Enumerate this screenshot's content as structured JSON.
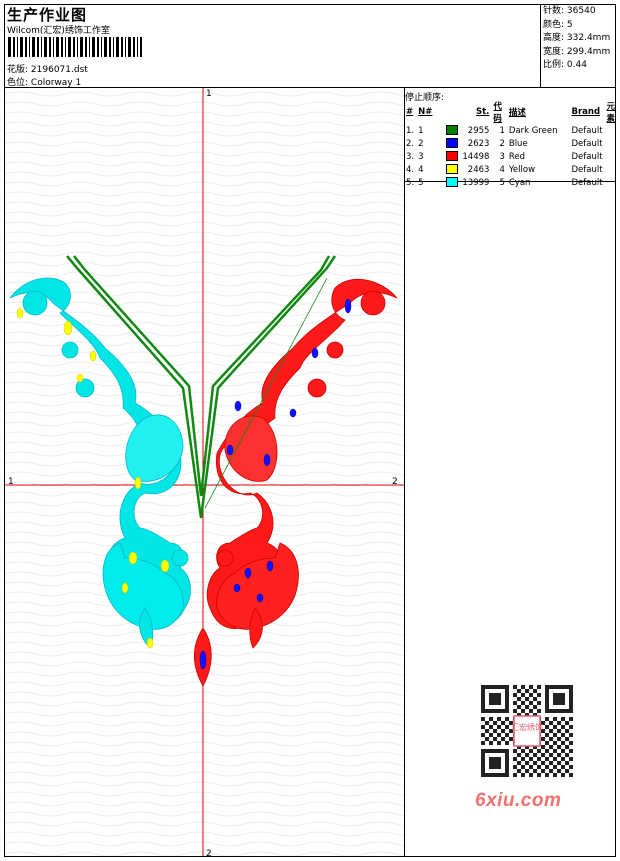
{
  "header": {
    "title": "生产作业图",
    "subtitle": "Wilcom(汇宏)绣饰工作室",
    "file_label": "花版:",
    "file_name": "2196071.dst",
    "colorway_label": "色位:",
    "colorway": "Colorway 1"
  },
  "stats": [
    {
      "label": "针数:",
      "value": "36540"
    },
    {
      "label": "颜色:",
      "value": "5"
    },
    {
      "label": "高度:",
      "value": "332.4mm"
    },
    {
      "label": "宽度:",
      "value": "299.4mm"
    },
    {
      "label": "比例:",
      "value": "0.44"
    }
  ],
  "stop_sequence": {
    "title": "停止顺序:",
    "headers": [
      "#",
      "N#",
      "St.",
      "代码",
      "描述",
      "Brand",
      "元素"
    ],
    "rows": [
      {
        "idx": "1.",
        "n": "1",
        "color": "#008000",
        "st": "2955",
        "code": "1",
        "desc": "Dark Green",
        "brand": "Default"
      },
      {
        "idx": "2.",
        "n": "2",
        "color": "#0000ff",
        "st": "2623",
        "code": "2",
        "desc": "Blue",
        "brand": "Default"
      },
      {
        "idx": "3.",
        "n": "3",
        "color": "#ff0000",
        "st": "14498",
        "code": "3",
        "desc": "Red",
        "brand": "Default"
      },
      {
        "idx": "4.",
        "n": "4",
        "color": "#ffff00",
        "st": "2463",
        "code": "4",
        "desc": "Yellow",
        "brand": "Default"
      },
      {
        "idx": "5.",
        "n": "5",
        "color": "#00ffff",
        "st": "13999",
        "code": "5",
        "desc": "Cyan",
        "brand": "Default"
      }
    ]
  },
  "axes": {
    "top_label": "1",
    "left_label": "1",
    "right_label": "2",
    "bottom_label": "2"
  },
  "watermark": "6xiu.com",
  "qr_stamp": "汇宏绣饰"
}
